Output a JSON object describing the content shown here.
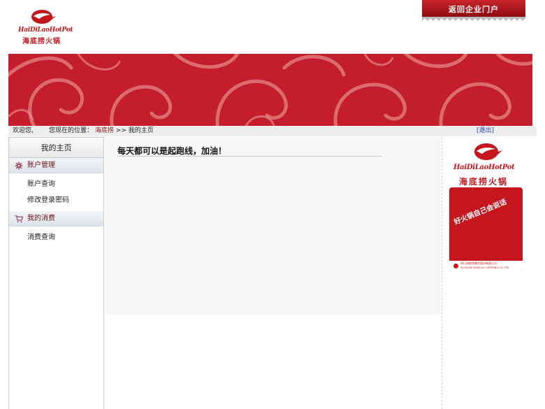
{
  "header": {
    "logo_en": "HaiDiLaoHotPot",
    "logo_cn": "海底捞火锅",
    "portal_link": "返回企业门户"
  },
  "breadcrumb": {
    "welcome": "欢迎您,",
    "location_prefix": "您现在的位置：",
    "root": "海底捞",
    "separator": ">>",
    "current": "我的主页",
    "logout": "[退出]"
  },
  "sidebar": {
    "title": "我的主页",
    "groups": [
      {
        "label": "账户管理",
        "icon": "gear-icon",
        "items": [
          "账户查询",
          "修改登录密码"
        ]
      },
      {
        "label": "我的消费",
        "icon": "cart-icon",
        "items": [
          "消费查询"
        ]
      }
    ]
  },
  "main": {
    "message": "每天都可以是起跑线，加油！"
  },
  "ad": {
    "logo_en": "HaiDiLaoHotPot",
    "logo_cn": "海底捞火锅",
    "slogan": "好火锅自己会说话",
    "company_cn": "四川海底捞餐饮股份有限公司",
    "company_en": "SICHUAN HAIDILAO CATERING CO.,LTD"
  },
  "colors": {
    "brand_red": "#c4161c",
    "banner_red": "#c41d2b",
    "main_bg": "#f6f6f6"
  }
}
